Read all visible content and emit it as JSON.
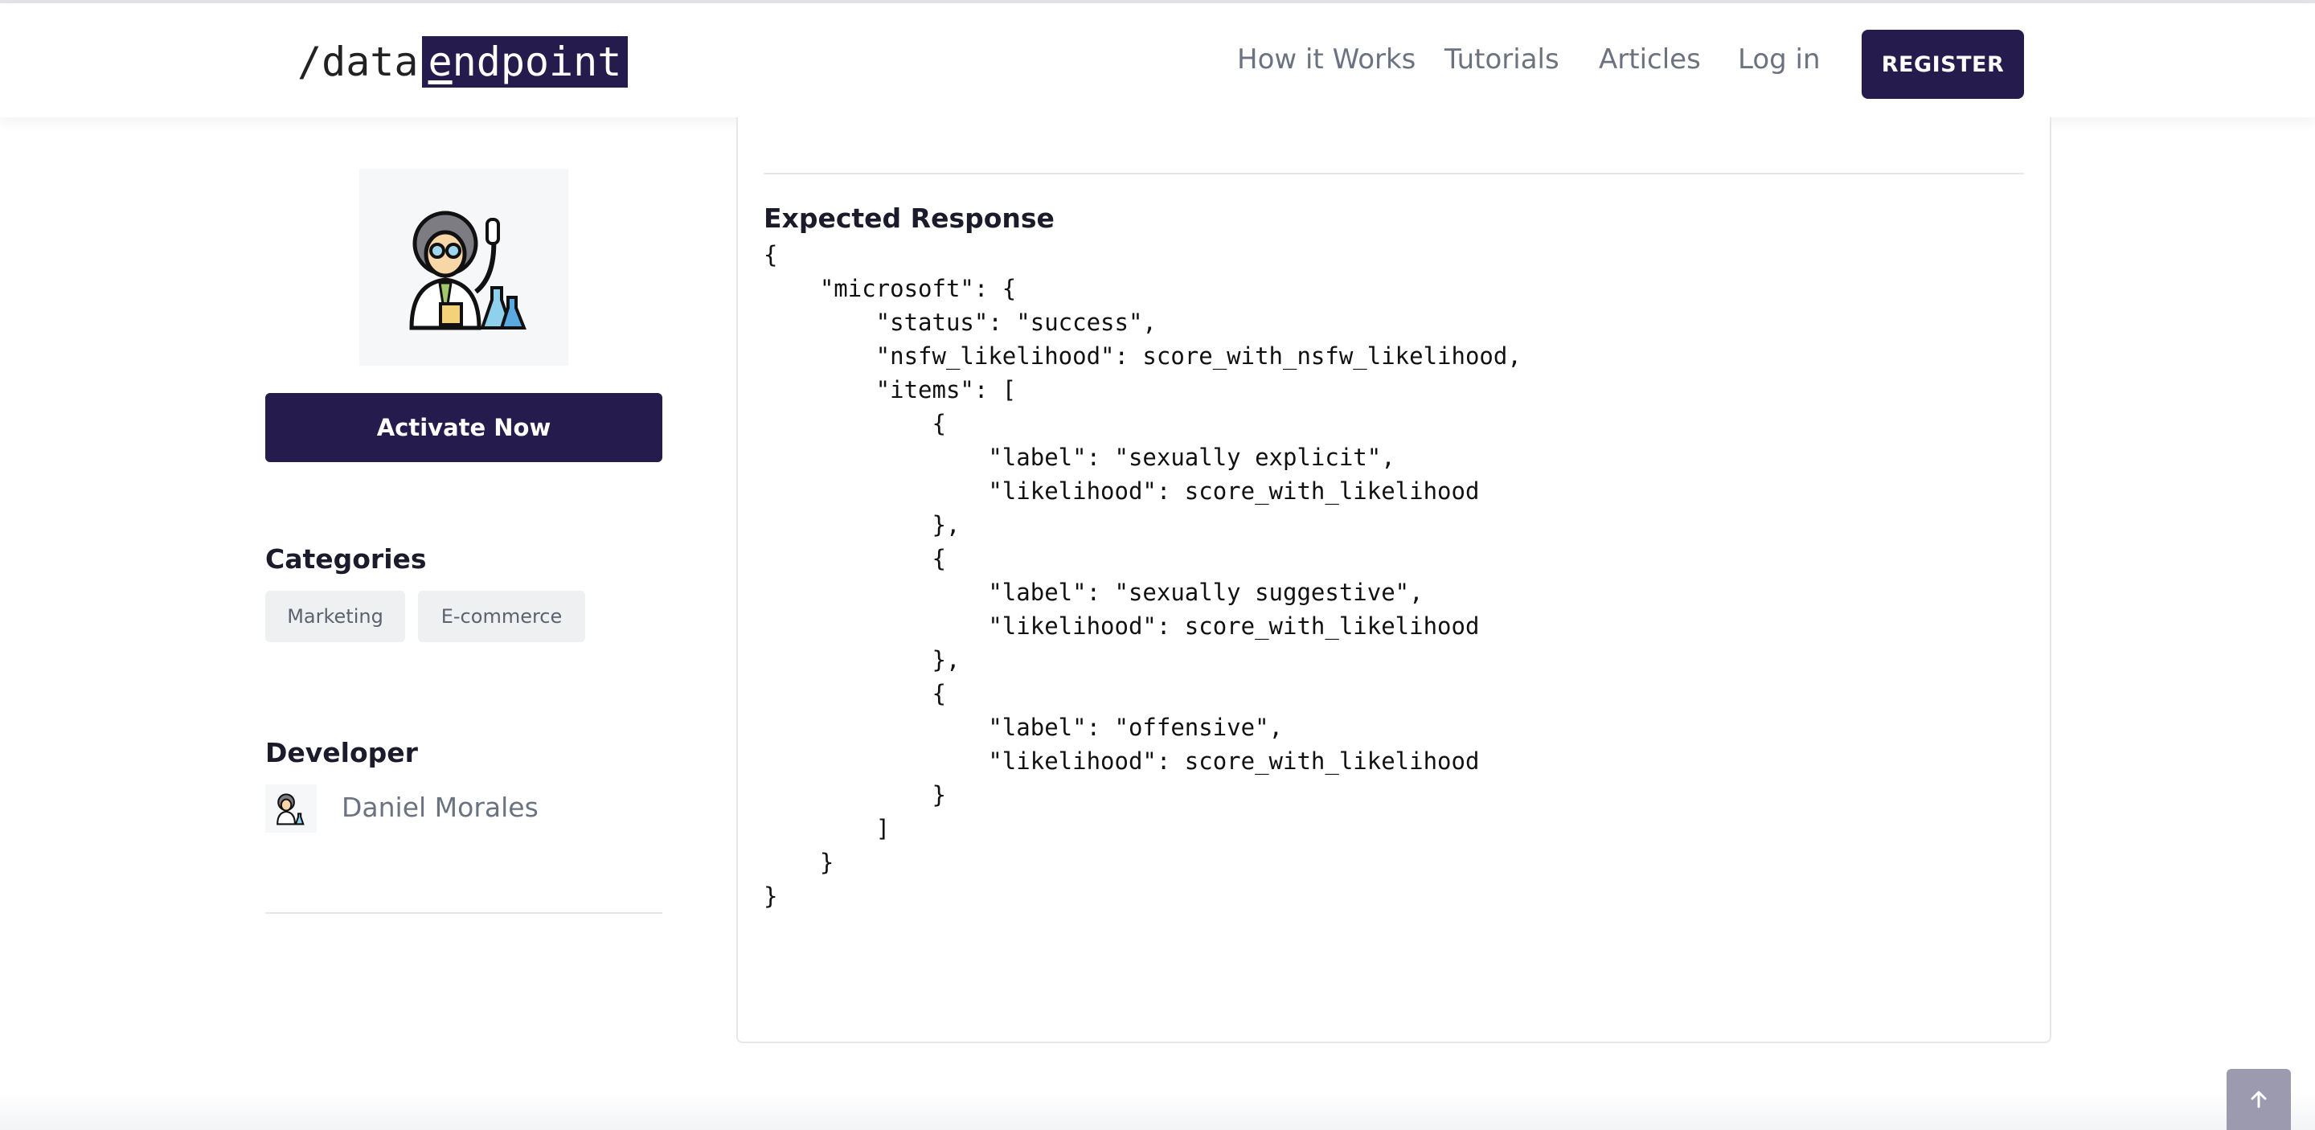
{
  "header": {
    "logo_prefix": "/data",
    "logo_highlight_first": "e",
    "logo_highlight_rest": "ndpoint",
    "nav": [
      "How it Works",
      "Tutorials",
      "Articles",
      "Log in"
    ],
    "register_label": "REGISTER"
  },
  "sidebar": {
    "avatar_icon": "scientist-icon",
    "activate_label": "Activate Now",
    "categories_heading": "Categories",
    "categories": [
      "Marketing",
      "E-commerce"
    ],
    "developer_heading": "Developer",
    "developer_name": "Daniel Morales"
  },
  "main": {
    "response_title": "Expected Response",
    "response_code": "{\n    \"microsoft\": {\n        \"status\": \"success\",\n        \"nsfw_likelihood\": score_with_nsfw_likelihood,\n        \"items\": [\n            {\n                \"label\": \"sexually explicit\",\n                \"likelihood\": score_with_likelihood\n            },\n            {\n                \"label\": \"sexually suggestive\",\n                \"likelihood\": score_with_likelihood\n            },\n            {\n                \"label\": \"offensive\",\n                \"likelihood\": score_with_likelihood\n            }\n        ]\n    }\n}"
  },
  "colors": {
    "brand": "#251b4d",
    "scroll_top": "#9c9aaf"
  },
  "scroll_top_icon": "arrow-up-icon"
}
